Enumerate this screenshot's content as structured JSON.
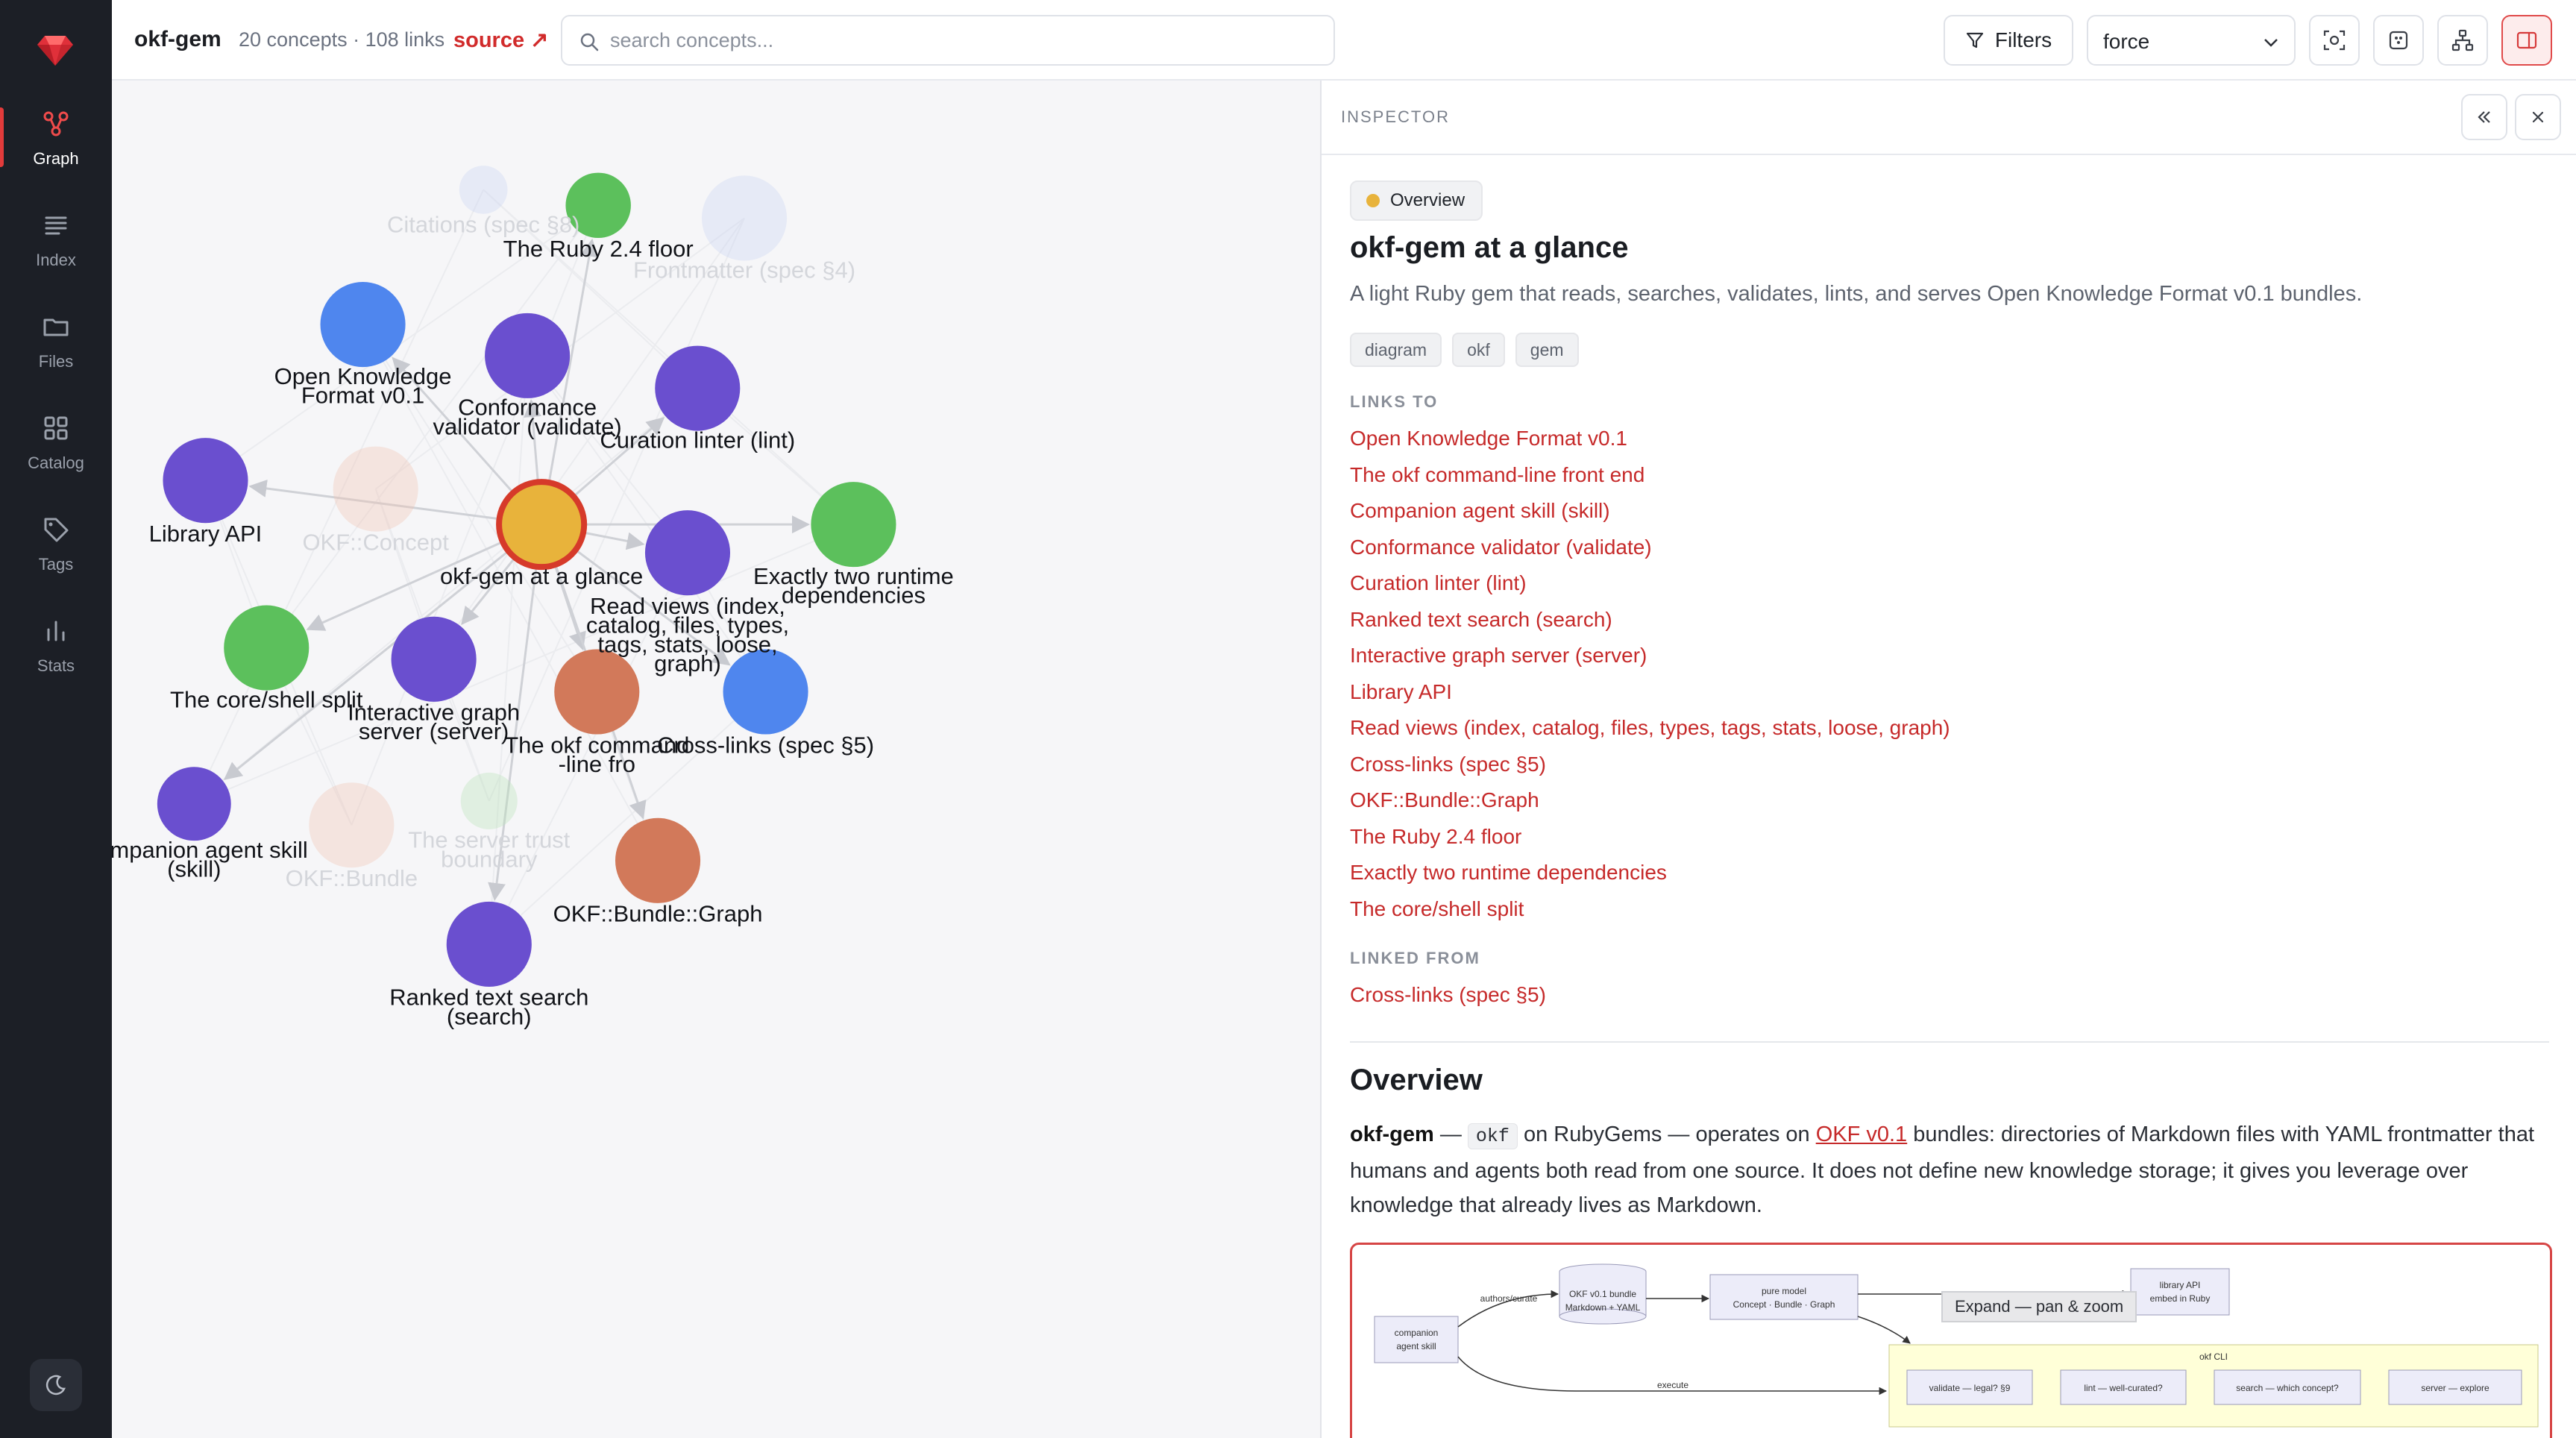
{
  "app": {
    "name": "okf-gem",
    "counts": "20 concepts · 108 links",
    "source_label": "source ↗",
    "search_placeholder": "search concepts..."
  },
  "sidebar": {
    "items": [
      {
        "label": "Graph",
        "icon": "graph-icon",
        "active": true
      },
      {
        "label": "Index",
        "icon": "list-icon"
      },
      {
        "label": "Files",
        "icon": "folder-icon"
      },
      {
        "label": "Catalog",
        "icon": "grid-icon"
      },
      {
        "label": "Tags",
        "icon": "tag-icon"
      },
      {
        "label": "Stats",
        "icon": "bar-chart-icon"
      }
    ],
    "bottom_icon": "moon-icon"
  },
  "toolbar": {
    "filters_label": "Filters",
    "layout_value": "force",
    "icons": [
      "focus-icon",
      "screenshot-icon",
      "hierarchy-icon",
      "panel-toggle-icon"
    ]
  },
  "graph": {
    "nodes": [
      {
        "id": "citations",
        "label": "Citations (spec §8)",
        "faded": true,
        "color": "#c9d4f3"
      },
      {
        "id": "ruby24",
        "label": "The Ruby 2.4 floor",
        "color": "#5cc05c"
      },
      {
        "id": "frontmatter",
        "label": "Frontmatter (spec §4)",
        "faded": true,
        "color": "#c9d4f3"
      },
      {
        "id": "okfv01",
        "label": "Open Knowledge Format v0.1",
        "color": "#4f86ee"
      },
      {
        "id": "validator",
        "label": "Conformance validator (validate)",
        "color": "#6a4fcf"
      },
      {
        "id": "linter",
        "label": "Curation linter (lint)",
        "color": "#6a4fcf"
      },
      {
        "id": "libapi",
        "label": "Library API",
        "color": "#6a4fcf"
      },
      {
        "id": "concept",
        "label": "OKF::Concept",
        "faded": true,
        "color": "#f0c3b3"
      },
      {
        "id": "glance",
        "label": "okf-gem at a glance",
        "color": "#e8b33b",
        "selected": true
      },
      {
        "id": "readviews",
        "label": "Read views (index, catalog, files, types, tags, stats, loose, graph)",
        "color": "#6a4fcf"
      },
      {
        "id": "tworuntime",
        "label": "Exactly two runtime dependencies",
        "color": "#5cc05c"
      },
      {
        "id": "coreshell",
        "label": "The core/shell split",
        "color": "#5cc05c"
      },
      {
        "id": "server",
        "label": "Interactive graph server (server)",
        "color": "#6a4fcf"
      },
      {
        "id": "cli",
        "label": "The okf command-line front end",
        "color": "#d2795a"
      },
      {
        "id": "crosslinks",
        "label": "Cross-links (spec §5)",
        "color": "#4f86ee"
      },
      {
        "id": "skill",
        "label": "Companion agent skill (skill)",
        "color": "#6a4fcf"
      },
      {
        "id": "bundle",
        "label": "OKF::Bundle",
        "faded": true,
        "color": "#f0c3b3"
      },
      {
        "id": "trust",
        "label": "The server trust boundary",
        "faded": true,
        "color": "#b8e3b8"
      },
      {
        "id": "bundlegraph",
        "label": "OKF::Bundle::Graph",
        "color": "#d2795a"
      },
      {
        "id": "search",
        "label": "Ranked text search (search)",
        "color": "#6a4fcf"
      }
    ]
  },
  "inspector": {
    "header": "INSPECTOR",
    "badge": "Overview",
    "badge_color": "#e8b33b",
    "title": "okf-gem at a glance",
    "description": "A light Ruby gem that reads, searches, validates, lints, and serves Open Knowledge Format v0.1 bundles.",
    "tags": [
      "diagram",
      "okf",
      "gem"
    ],
    "links_to_heading": "LINKS TO",
    "links_to": [
      "Open Knowledge Format v0.1",
      "The okf command-line front end",
      "Companion agent skill (skill)",
      "Conformance validator (validate)",
      "Curation linter (lint)",
      "Ranked text search (search)",
      "Interactive graph server (server)",
      "Library API",
      "Read views (index, catalog, files, types, tags, stats, loose, graph)",
      "Cross-links (spec §5)",
      "OKF::Bundle::Graph",
      "The Ruby 2.4 floor",
      "Exactly two runtime dependencies",
      "The core/shell split"
    ],
    "linked_from_heading": "LINKED FROM",
    "linked_from": [
      "Cross-links (spec §5)"
    ],
    "overview_heading": "Overview",
    "overview": {
      "name": "okf-gem",
      "dash1": " — ",
      "code": "okf",
      "mid1": " on RubyGems — operates on ",
      "link": "OKF v0.1",
      "rest": " bundles: directories of Markdown files with YAML frontmatter that humans and agents both read from one source. It does not define new knowledge storage; it gives you leverage over knowledge that already lives as Markdown."
    },
    "diagram": {
      "expand_label": "Expand — pan & zoom",
      "skill_box": [
        "companion",
        "agent skill"
      ],
      "edge_author": "authors/curate",
      "bundle_box": [
        "OKF v0.1 bundle",
        "Markdown + YAML"
      ],
      "model_box": [
        "pure model",
        "Concept · Bundle · Graph"
      ],
      "lib_box": [
        "library API",
        "embed in Ruby"
      ],
      "cli_group": "okf CLI",
      "edge_execute": "execute",
      "cmds": [
        "validate — legal? §9",
        "lint — well-curated?",
        "search — which concept?",
        "server — explore"
      ]
    }
  }
}
